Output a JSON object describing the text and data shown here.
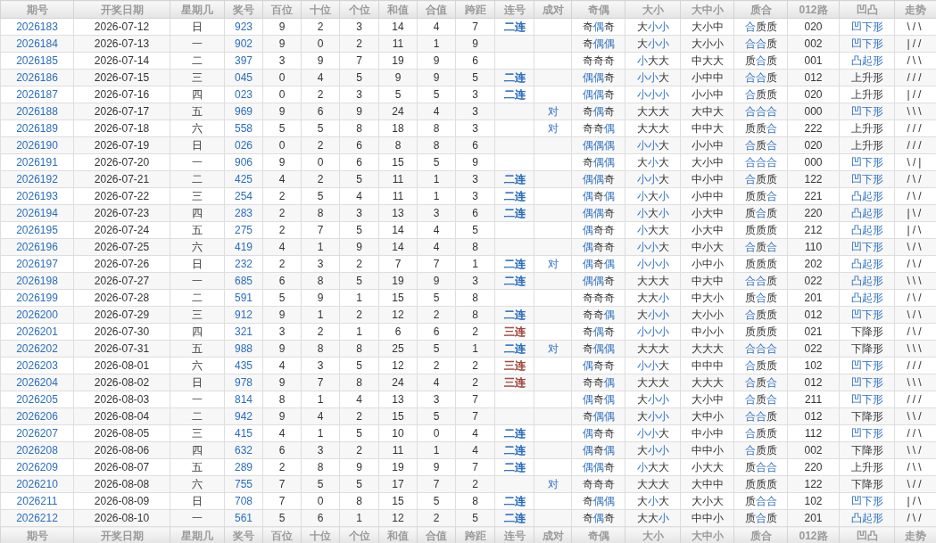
{
  "header": [
    "期号",
    "开奖日期",
    "星期几",
    "奖号",
    "百位",
    "十位",
    "个位",
    "和值",
    "合值",
    "跨距",
    "连号",
    "成对",
    "奇偶",
    "大小",
    "大中小",
    "质合",
    "012路",
    "凹凸",
    "走势"
  ],
  "rows": [
    {
      "issue": "2026183",
      "date": "2026-07-12",
      "weekday": "日",
      "number": "923",
      "hundreds": "9",
      "tens": "2",
      "units": "3",
      "sum": "14",
      "sum_tail": "4",
      "span": "7",
      "consecutive": {
        "text": "二连",
        "color": "#2a6ebf"
      },
      "odd_even": [
        {
          "ch": "奇",
          "hl": false
        },
        {
          "ch": "偶",
          "hl": true
        },
        {
          "ch": "奇",
          "hl": false
        }
      ],
      "big_small": [
        {
          "ch": "大",
          "hl": false
        },
        {
          "ch": "小",
          "hl": true
        },
        {
          "ch": "小",
          "hl": true
        }
      ],
      "big_mid_small": "大小中",
      "prime_composite": [
        {
          "ch": "合",
          "hl": true
        },
        {
          "ch": "质",
          "hl": false
        },
        {
          "ch": "质",
          "hl": false
        }
      ],
      "route_012": "020",
      "shape": {
        "text": "凹下形",
        "highlight": true
      },
      "trend": "\\/\\"
    },
    {
      "issue": "2026184",
      "date": "2026-07-13",
      "weekday": "一",
      "number": "902",
      "hundreds": "9",
      "tens": "0",
      "units": "2",
      "sum": "11",
      "sum_tail": "1",
      "span": "9",
      "odd_even": [
        {
          "ch": "奇",
          "hl": false
        },
        {
          "ch": "偶",
          "hl": true
        },
        {
          "ch": "偶",
          "hl": true
        }
      ],
      "big_small": [
        {
          "ch": "大",
          "hl": false
        },
        {
          "ch": "小",
          "hl": true
        },
        {
          "ch": "小",
          "hl": true
        }
      ],
      "big_mid_small": "大小小",
      "prime_composite": [
        {
          "ch": "合",
          "hl": true
        },
        {
          "ch": "合",
          "hl": true
        },
        {
          "ch": "质",
          "hl": false
        }
      ],
      "route_012": "002",
      "shape": {
        "text": "凹下形",
        "highlight": true
      },
      "trend": "|//"
    },
    {
      "issue": "2026185",
      "date": "2026-07-14",
      "weekday": "二",
      "number": "397",
      "hundreds": "3",
      "tens": "9",
      "units": "7",
      "sum": "19",
      "sum_tail": "9",
      "span": "6",
      "odd_even": [
        {
          "ch": "奇",
          "hl": false
        },
        {
          "ch": "奇",
          "hl": false
        },
        {
          "ch": "奇",
          "hl": false
        }
      ],
      "big_small": [
        {
          "ch": "小",
          "hl": true
        },
        {
          "ch": "大",
          "hl": false
        },
        {
          "ch": "大",
          "hl": false
        }
      ],
      "big_mid_small": "中大大",
      "prime_composite": [
        {
          "ch": "质",
          "hl": false
        },
        {
          "ch": "合",
          "hl": true
        },
        {
          "ch": "质",
          "hl": false
        }
      ],
      "route_012": "001",
      "shape": {
        "text": "凸起形",
        "highlight": true
      },
      "trend": "/\\\\"
    },
    {
      "issue": "2026186",
      "date": "2026-07-15",
      "weekday": "三",
      "number": "045",
      "hundreds": "0",
      "tens": "4",
      "units": "5",
      "sum": "9",
      "sum_tail": "9",
      "span": "5",
      "consecutive": {
        "text": "二连",
        "color": "#2a6ebf"
      },
      "odd_even": [
        {
          "ch": "偶",
          "hl": true
        },
        {
          "ch": "偶",
          "hl": true
        },
        {
          "ch": "奇",
          "hl": false
        }
      ],
      "big_small": [
        {
          "ch": "小",
          "hl": true
        },
        {
          "ch": "小",
          "hl": true
        },
        {
          "ch": "大",
          "hl": false
        }
      ],
      "big_mid_small": "小中中",
      "prime_composite": [
        {
          "ch": "合",
          "hl": true
        },
        {
          "ch": "合",
          "hl": true
        },
        {
          "ch": "质",
          "hl": false
        }
      ],
      "route_012": "012",
      "shape": {
        "text": "上升形",
        "highlight": false
      },
      "trend": "///"
    },
    {
      "issue": "2026187",
      "date": "2026-07-16",
      "weekday": "四",
      "number": "023",
      "hundreds": "0",
      "tens": "2",
      "units": "3",
      "sum": "5",
      "sum_tail": "5",
      "span": "3",
      "consecutive": {
        "text": "二连",
        "color": "#2a6ebf"
      },
      "odd_even": [
        {
          "ch": "偶",
          "hl": true
        },
        {
          "ch": "偶",
          "hl": true
        },
        {
          "ch": "奇",
          "hl": false
        }
      ],
      "big_small": [
        {
          "ch": "小",
          "hl": true
        },
        {
          "ch": "小",
          "hl": true
        },
        {
          "ch": "小",
          "hl": true
        }
      ],
      "big_mid_small": "小小中",
      "prime_composite": [
        {
          "ch": "合",
          "hl": true
        },
        {
          "ch": "质",
          "hl": false
        },
        {
          "ch": "质",
          "hl": false
        }
      ],
      "route_012": "020",
      "shape": {
        "text": "上升形",
        "highlight": false
      },
      "trend": "|//"
    },
    {
      "issue": "2026188",
      "date": "2026-07-17",
      "weekday": "五",
      "number": "969",
      "hundreds": "9",
      "tens": "6",
      "units": "9",
      "sum": "24",
      "sum_tail": "4",
      "span": "3",
      "pair": "对",
      "odd_even": [
        {
          "ch": "奇",
          "hl": false
        },
        {
          "ch": "偶",
          "hl": true
        },
        {
          "ch": "奇",
          "hl": false
        }
      ],
      "big_small": [
        {
          "ch": "大",
          "hl": false
        },
        {
          "ch": "大",
          "hl": false
        },
        {
          "ch": "大",
          "hl": false
        }
      ],
      "big_mid_small": "大中大",
      "prime_composite": [
        {
          "ch": "合",
          "hl": true
        },
        {
          "ch": "合",
          "hl": true
        },
        {
          "ch": "合",
          "hl": true
        }
      ],
      "route_012": "000",
      "shape": {
        "text": "凹下形",
        "highlight": true
      },
      "trend": "\\\\\\"
    },
    {
      "issue": "2026189",
      "date": "2026-07-18",
      "weekday": "六",
      "number": "558",
      "hundreds": "5",
      "tens": "5",
      "units": "8",
      "sum": "18",
      "sum_tail": "8",
      "span": "3",
      "pair": "对",
      "odd_even": [
        {
          "ch": "奇",
          "hl": false
        },
        {
          "ch": "奇",
          "hl": false
        },
        {
          "ch": "偶",
          "hl": true
        }
      ],
      "big_small": [
        {
          "ch": "大",
          "hl": false
        },
        {
          "ch": "大",
          "hl": false
        },
        {
          "ch": "大",
          "hl": false
        }
      ],
      "big_mid_small": "中中大",
      "prime_composite": [
        {
          "ch": "质",
          "hl": false
        },
        {
          "ch": "质",
          "hl": false
        },
        {
          "ch": "合",
          "hl": true
        }
      ],
      "route_012": "222",
      "shape": {
        "text": "上升形",
        "highlight": false
      },
      "trend": "///"
    },
    {
      "issue": "2026190",
      "date": "2026-07-19",
      "weekday": "日",
      "number": "026",
      "hundreds": "0",
      "tens": "2",
      "units": "6",
      "sum": "8",
      "sum_tail": "8",
      "span": "6",
      "odd_even": [
        {
          "ch": "偶",
          "hl": true
        },
        {
          "ch": "偶",
          "hl": true
        },
        {
          "ch": "偶",
          "hl": true
        }
      ],
      "big_small": [
        {
          "ch": "小",
          "hl": true
        },
        {
          "ch": "小",
          "hl": true
        },
        {
          "ch": "大",
          "hl": false
        }
      ],
      "big_mid_small": "小小中",
      "prime_composite": [
        {
          "ch": "合",
          "hl": true
        },
        {
          "ch": "质",
          "hl": false
        },
        {
          "ch": "合",
          "hl": true
        }
      ],
      "route_012": "020",
      "shape": {
        "text": "上升形",
        "highlight": false
      },
      "trend": "///"
    },
    {
      "issue": "2026191",
      "date": "2026-07-20",
      "weekday": "一",
      "number": "906",
      "hundreds": "9",
      "tens": "0",
      "units": "6",
      "sum": "15",
      "sum_tail": "5",
      "span": "9",
      "odd_even": [
        {
          "ch": "奇",
          "hl": false
        },
        {
          "ch": "偶",
          "hl": true
        },
        {
          "ch": "偶",
          "hl": true
        }
      ],
      "big_small": [
        {
          "ch": "大",
          "hl": false
        },
        {
          "ch": "小",
          "hl": true
        },
        {
          "ch": "大",
          "hl": false
        }
      ],
      "big_mid_small": "大小中",
      "prime_composite": [
        {
          "ch": "合",
          "hl": true
        },
        {
          "ch": "合",
          "hl": true
        },
        {
          "ch": "合",
          "hl": true
        }
      ],
      "route_012": "000",
      "shape": {
        "text": "凹下形",
        "highlight": true
      },
      "trend": "\\/|"
    },
    {
      "issue": "2026192",
      "date": "2026-07-21",
      "weekday": "二",
      "number": "425",
      "hundreds": "4",
      "tens": "2",
      "units": "5",
      "sum": "11",
      "sum_tail": "1",
      "span": "3",
      "consecutive": {
        "text": "二连",
        "color": "#2a6ebf"
      },
      "odd_even": [
        {
          "ch": "偶",
          "hl": true
        },
        {
          "ch": "偶",
          "hl": true
        },
        {
          "ch": "奇",
          "hl": false
        }
      ],
      "big_small": [
        {
          "ch": "小",
          "hl": true
        },
        {
          "ch": "小",
          "hl": true
        },
        {
          "ch": "大",
          "hl": false
        }
      ],
      "big_mid_small": "中小中",
      "prime_composite": [
        {
          "ch": "合",
          "hl": true
        },
        {
          "ch": "质",
          "hl": false
        },
        {
          "ch": "质",
          "hl": false
        }
      ],
      "route_012": "122",
      "shape": {
        "text": "凹下形",
        "highlight": true
      },
      "trend": "/\\/"
    },
    {
      "issue": "2026193",
      "date": "2026-07-22",
      "weekday": "三",
      "number": "254",
      "hundreds": "2",
      "tens": "5",
      "units": "4",
      "sum": "11",
      "sum_tail": "1",
      "span": "3",
      "consecutive": {
        "text": "二连",
        "color": "#2a6ebf"
      },
      "odd_even": [
        {
          "ch": "偶",
          "hl": true
        },
        {
          "ch": "奇",
          "hl": false
        },
        {
          "ch": "偶",
          "hl": true
        }
      ],
      "big_small": [
        {
          "ch": "小",
          "hl": true
        },
        {
          "ch": "大",
          "hl": false
        },
        {
          "ch": "小",
          "hl": true
        }
      ],
      "big_mid_small": "小中中",
      "prime_composite": [
        {
          "ch": "质",
          "hl": false
        },
        {
          "ch": "质",
          "hl": false
        },
        {
          "ch": "合",
          "hl": true
        }
      ],
      "route_012": "221",
      "shape": {
        "text": "凸起形",
        "highlight": true
      },
      "trend": "/\\/"
    },
    {
      "issue": "2026194",
      "date": "2026-07-23",
      "weekday": "四",
      "number": "283",
      "hundreds": "2",
      "tens": "8",
      "units": "3",
      "sum": "13",
      "sum_tail": "3",
      "span": "6",
      "consecutive": {
        "text": "二连",
        "color": "#2a6ebf"
      },
      "odd_even": [
        {
          "ch": "偶",
          "hl": true
        },
        {
          "ch": "偶",
          "hl": true
        },
        {
          "ch": "奇",
          "hl": false
        }
      ],
      "big_small": [
        {
          "ch": "小",
          "hl": true
        },
        {
          "ch": "大",
          "hl": false
        },
        {
          "ch": "小",
          "hl": true
        }
      ],
      "big_mid_small": "小大中",
      "prime_composite": [
        {
          "ch": "质",
          "hl": false
        },
        {
          "ch": "合",
          "hl": true
        },
        {
          "ch": "质",
          "hl": false
        }
      ],
      "route_012": "220",
      "shape": {
        "text": "凸起形",
        "highlight": true
      },
      "trend": "|\\/"
    },
    {
      "issue": "2026195",
      "date": "2026-07-24",
      "weekday": "五",
      "number": "275",
      "hundreds": "2",
      "tens": "7",
      "units": "5",
      "sum": "14",
      "sum_tail": "4",
      "span": "5",
      "odd_even": [
        {
          "ch": "偶",
          "hl": true
        },
        {
          "ch": "奇",
          "hl": false
        },
        {
          "ch": "奇",
          "hl": false
        }
      ],
      "big_small": [
        {
          "ch": "小",
          "hl": true
        },
        {
          "ch": "大",
          "hl": false
        },
        {
          "ch": "大",
          "hl": false
        }
      ],
      "big_mid_small": "小大中",
      "prime_composite": [
        {
          "ch": "质",
          "hl": false
        },
        {
          "ch": "质",
          "hl": false
        },
        {
          "ch": "质",
          "hl": false
        }
      ],
      "route_012": "212",
      "shape": {
        "text": "凸起形",
        "highlight": true
      },
      "trend": "|/\\"
    },
    {
      "issue": "2026196",
      "date": "2026-07-25",
      "weekday": "六",
      "number": "419",
      "hundreds": "4",
      "tens": "1",
      "units": "9",
      "sum": "14",
      "sum_tail": "4",
      "span": "8",
      "odd_even": [
        {
          "ch": "偶",
          "hl": true
        },
        {
          "ch": "奇",
          "hl": false
        },
        {
          "ch": "奇",
          "hl": false
        }
      ],
      "big_small": [
        {
          "ch": "小",
          "hl": true
        },
        {
          "ch": "小",
          "hl": true
        },
        {
          "ch": "大",
          "hl": false
        }
      ],
      "big_mid_small": "中小大",
      "prime_composite": [
        {
          "ch": "合",
          "hl": true
        },
        {
          "ch": "质",
          "hl": false
        },
        {
          "ch": "合",
          "hl": true
        }
      ],
      "route_012": "110",
      "shape": {
        "text": "凹下形",
        "highlight": true
      },
      "trend": "\\/\\"
    },
    {
      "issue": "2026197",
      "date": "2026-07-26",
      "weekday": "日",
      "number": "232",
      "hundreds": "2",
      "tens": "3",
      "units": "2",
      "sum": "7",
      "sum_tail": "7",
      "span": "1",
      "consecutive": {
        "text": "二连",
        "color": "#2a6ebf"
      },
      "pair": "对",
      "odd_even": [
        {
          "ch": "偶",
          "hl": true
        },
        {
          "ch": "奇",
          "hl": false
        },
        {
          "ch": "偶",
          "hl": true
        }
      ],
      "big_small": [
        {
          "ch": "小",
          "hl": true
        },
        {
          "ch": "小",
          "hl": true
        },
        {
          "ch": "小",
          "hl": true
        }
      ],
      "big_mid_small": "小中小",
      "prime_composite": [
        {
          "ch": "质",
          "hl": false
        },
        {
          "ch": "质",
          "hl": false
        },
        {
          "ch": "质",
          "hl": false
        }
      ],
      "route_012": "202",
      "shape": {
        "text": "凸起形",
        "highlight": true
      },
      "trend": "/\\/"
    },
    {
      "issue": "2026198",
      "date": "2026-07-27",
      "weekday": "一",
      "number": "685",
      "hundreds": "6",
      "tens": "8",
      "units": "5",
      "sum": "19",
      "sum_tail": "9",
      "span": "3",
      "consecutive": {
        "text": "二连",
        "color": "#2a6ebf"
      },
      "odd_even": [
        {
          "ch": "偶",
          "hl": true
        },
        {
          "ch": "偶",
          "hl": true
        },
        {
          "ch": "奇",
          "hl": false
        }
      ],
      "big_small": [
        {
          "ch": "大",
          "hl": false
        },
        {
          "ch": "大",
          "hl": false
        },
        {
          "ch": "大",
          "hl": false
        }
      ],
      "big_mid_small": "中大中",
      "prime_composite": [
        {
          "ch": "合",
          "hl": true
        },
        {
          "ch": "合",
          "hl": true
        },
        {
          "ch": "质",
          "hl": false
        }
      ],
      "route_012": "022",
      "shape": {
        "text": "凸起形",
        "highlight": true
      },
      "trend": "\\\\\\"
    },
    {
      "issue": "2026199",
      "date": "2026-07-28",
      "weekday": "二",
      "number": "591",
      "hundreds": "5",
      "tens": "9",
      "units": "1",
      "sum": "15",
      "sum_tail": "5",
      "span": "8",
      "odd_even": [
        {
          "ch": "奇",
          "hl": false
        },
        {
          "ch": "奇",
          "hl": false
        },
        {
          "ch": "奇",
          "hl": false
        }
      ],
      "big_small": [
        {
          "ch": "大",
          "hl": false
        },
        {
          "ch": "大",
          "hl": false
        },
        {
          "ch": "小",
          "hl": true
        }
      ],
      "big_mid_small": "中大小",
      "prime_composite": [
        {
          "ch": "质",
          "hl": false
        },
        {
          "ch": "合",
          "hl": true
        },
        {
          "ch": "质",
          "hl": false
        }
      ],
      "route_012": "201",
      "shape": {
        "text": "凸起形",
        "highlight": true
      },
      "trend": "/\\/"
    },
    {
      "issue": "2026200",
      "date": "2026-07-29",
      "weekday": "三",
      "number": "912",
      "hundreds": "9",
      "tens": "1",
      "units": "2",
      "sum": "12",
      "sum_tail": "2",
      "span": "8",
      "consecutive": {
        "text": "二连",
        "color": "#2a6ebf"
      },
      "odd_even": [
        {
          "ch": "奇",
          "hl": false
        },
        {
          "ch": "奇",
          "hl": false
        },
        {
          "ch": "偶",
          "hl": true
        }
      ],
      "big_small": [
        {
          "ch": "大",
          "hl": false
        },
        {
          "ch": "小",
          "hl": true
        },
        {
          "ch": "小",
          "hl": true
        }
      ],
      "big_mid_small": "大小小",
      "prime_composite": [
        {
          "ch": "合",
          "hl": true
        },
        {
          "ch": "质",
          "hl": false
        },
        {
          "ch": "质",
          "hl": false
        }
      ],
      "route_012": "012",
      "shape": {
        "text": "凹下形",
        "highlight": true
      },
      "trend": "\\/\\"
    },
    {
      "issue": "2026201",
      "date": "2026-07-30",
      "weekday": "四",
      "number": "321",
      "hundreds": "3",
      "tens": "2",
      "units": "1",
      "sum": "6",
      "sum_tail": "6",
      "span": "2",
      "consecutive": {
        "text": "三连",
        "color": "#a0473d"
      },
      "odd_even": [
        {
          "ch": "奇",
          "hl": false
        },
        {
          "ch": "偶",
          "hl": true
        },
        {
          "ch": "奇",
          "hl": false
        }
      ],
      "big_small": [
        {
          "ch": "小",
          "hl": true
        },
        {
          "ch": "小",
          "hl": true
        },
        {
          "ch": "小",
          "hl": true
        }
      ],
      "big_mid_small": "中小小",
      "prime_composite": [
        {
          "ch": "质",
          "hl": false
        },
        {
          "ch": "质",
          "hl": false
        },
        {
          "ch": "质",
          "hl": false
        }
      ],
      "route_012": "021",
      "shape": {
        "text": "下降形",
        "highlight": false
      },
      "trend": "/\\/"
    },
    {
      "issue": "2026202",
      "date": "2026-07-31",
      "weekday": "五",
      "number": "988",
      "hundreds": "9",
      "tens": "8",
      "units": "8",
      "sum": "25",
      "sum_tail": "5",
      "span": "1",
      "consecutive": {
        "text": "二连",
        "color": "#2a6ebf"
      },
      "pair": "对",
      "odd_even": [
        {
          "ch": "奇",
          "hl": false
        },
        {
          "ch": "偶",
          "hl": true
        },
        {
          "ch": "偶",
          "hl": true
        }
      ],
      "big_small": [
        {
          "ch": "大",
          "hl": false
        },
        {
          "ch": "大",
          "hl": false
        },
        {
          "ch": "大",
          "hl": false
        }
      ],
      "big_mid_small": "大大大",
      "prime_composite": [
        {
          "ch": "合",
          "hl": true
        },
        {
          "ch": "合",
          "hl": true
        },
        {
          "ch": "合",
          "hl": true
        }
      ],
      "route_012": "022",
      "shape": {
        "text": "下降形",
        "highlight": false
      },
      "trend": "\\\\\\"
    },
    {
      "issue": "2026203",
      "date": "2026-08-01",
      "weekday": "六",
      "number": "435",
      "hundreds": "4",
      "tens": "3",
      "units": "5",
      "sum": "12",
      "sum_tail": "2",
      "span": "2",
      "consecutive": {
        "text": "三连",
        "color": "#a0473d"
      },
      "odd_even": [
        {
          "ch": "偶",
          "hl": true
        },
        {
          "ch": "奇",
          "hl": false
        },
        {
          "ch": "奇",
          "hl": false
        }
      ],
      "big_small": [
        {
          "ch": "小",
          "hl": true
        },
        {
          "ch": "小",
          "hl": true
        },
        {
          "ch": "大",
          "hl": false
        }
      ],
      "big_mid_small": "中中中",
      "prime_composite": [
        {
          "ch": "合",
          "hl": true
        },
        {
          "ch": "质",
          "hl": false
        },
        {
          "ch": "质",
          "hl": false
        }
      ],
      "route_012": "102",
      "shape": {
        "text": "凹下形",
        "highlight": true
      },
      "trend": "///"
    },
    {
      "issue": "2026204",
      "date": "2026-08-02",
      "weekday": "日",
      "number": "978",
      "hundreds": "9",
      "tens": "7",
      "units": "8",
      "sum": "24",
      "sum_tail": "4",
      "span": "2",
      "consecutive": {
        "text": "三连",
        "color": "#a0473d"
      },
      "odd_even": [
        {
          "ch": "奇",
          "hl": false
        },
        {
          "ch": "奇",
          "hl": false
        },
        {
          "ch": "偶",
          "hl": true
        }
      ],
      "big_small": [
        {
          "ch": "大",
          "hl": false
        },
        {
          "ch": "大",
          "hl": false
        },
        {
          "ch": "大",
          "hl": false
        }
      ],
      "big_mid_small": "大大大",
      "prime_composite": [
        {
          "ch": "合",
          "hl": true
        },
        {
          "ch": "质",
          "hl": false
        },
        {
          "ch": "合",
          "hl": true
        }
      ],
      "route_012": "012",
      "shape": {
        "text": "凹下形",
        "highlight": true
      },
      "trend": "\\\\\\"
    },
    {
      "issue": "2026205",
      "date": "2026-08-03",
      "weekday": "一",
      "number": "814",
      "hundreds": "8",
      "tens": "1",
      "units": "4",
      "sum": "13",
      "sum_tail": "3",
      "span": "7",
      "odd_even": [
        {
          "ch": "偶",
          "hl": true
        },
        {
          "ch": "奇",
          "hl": false
        },
        {
          "ch": "偶",
          "hl": true
        }
      ],
      "big_small": [
        {
          "ch": "大",
          "hl": false
        },
        {
          "ch": "小",
          "hl": true
        },
        {
          "ch": "小",
          "hl": true
        }
      ],
      "big_mid_small": "大小中",
      "prime_composite": [
        {
          "ch": "合",
          "hl": true
        },
        {
          "ch": "质",
          "hl": false
        },
        {
          "ch": "合",
          "hl": true
        }
      ],
      "route_012": "211",
      "shape": {
        "text": "凹下形",
        "highlight": true
      },
      "trend": "///"
    },
    {
      "issue": "2026206",
      "date": "2026-08-04",
      "weekday": "二",
      "number": "942",
      "hundreds": "9",
      "tens": "4",
      "units": "2",
      "sum": "15",
      "sum_tail": "5",
      "span": "7",
      "odd_even": [
        {
          "ch": "奇",
          "hl": false
        },
        {
          "ch": "偶",
          "hl": true
        },
        {
          "ch": "偶",
          "hl": true
        }
      ],
      "big_small": [
        {
          "ch": "大",
          "hl": false
        },
        {
          "ch": "小",
          "hl": true
        },
        {
          "ch": "小",
          "hl": true
        }
      ],
      "big_mid_small": "大中小",
      "prime_composite": [
        {
          "ch": "合",
          "hl": true
        },
        {
          "ch": "合",
          "hl": true
        },
        {
          "ch": "质",
          "hl": false
        }
      ],
      "route_012": "012",
      "shape": {
        "text": "下降形",
        "highlight": false
      },
      "trend": "\\\\/"
    },
    {
      "issue": "2026207",
      "date": "2026-08-05",
      "weekday": "三",
      "number": "415",
      "hundreds": "4",
      "tens": "1",
      "units": "5",
      "sum": "10",
      "sum_tail": "0",
      "span": "4",
      "consecutive": {
        "text": "二连",
        "color": "#2a6ebf"
      },
      "odd_even": [
        {
          "ch": "偶",
          "hl": true
        },
        {
          "ch": "奇",
          "hl": false
        },
        {
          "ch": "奇",
          "hl": false
        }
      ],
      "big_small": [
        {
          "ch": "小",
          "hl": true
        },
        {
          "ch": "小",
          "hl": true
        },
        {
          "ch": "大",
          "hl": false
        }
      ],
      "big_mid_small": "中小中",
      "prime_composite": [
        {
          "ch": "合",
          "hl": true
        },
        {
          "ch": "质",
          "hl": false
        },
        {
          "ch": "质",
          "hl": false
        }
      ],
      "route_012": "112",
      "shape": {
        "text": "凹下形",
        "highlight": true
      },
      "trend": "//\\"
    },
    {
      "issue": "2026208",
      "date": "2026-08-06",
      "weekday": "四",
      "number": "632",
      "hundreds": "6",
      "tens": "3",
      "units": "2",
      "sum": "11",
      "sum_tail": "1",
      "span": "4",
      "consecutive": {
        "text": "二连",
        "color": "#2a6ebf"
      },
      "odd_even": [
        {
          "ch": "偶",
          "hl": true
        },
        {
          "ch": "奇",
          "hl": false
        },
        {
          "ch": "偶",
          "hl": true
        }
      ],
      "big_small": [
        {
          "ch": "大",
          "hl": false
        },
        {
          "ch": "小",
          "hl": true
        },
        {
          "ch": "小",
          "hl": true
        }
      ],
      "big_mid_small": "中中小",
      "prime_composite": [
        {
          "ch": "合",
          "hl": true
        },
        {
          "ch": "质",
          "hl": false
        },
        {
          "ch": "质",
          "hl": false
        }
      ],
      "route_012": "002",
      "shape": {
        "text": "下降形",
        "highlight": false
      },
      "trend": "\\\\/"
    },
    {
      "issue": "2026209",
      "date": "2026-08-07",
      "weekday": "五",
      "number": "289",
      "hundreds": "2",
      "tens": "8",
      "units": "9",
      "sum": "19",
      "sum_tail": "9",
      "span": "7",
      "consecutive": {
        "text": "二连",
        "color": "#2a6ebf"
      },
      "odd_even": [
        {
          "ch": "偶",
          "hl": true
        },
        {
          "ch": "偶",
          "hl": true
        },
        {
          "ch": "奇",
          "hl": false
        }
      ],
      "big_small": [
        {
          "ch": "小",
          "hl": true
        },
        {
          "ch": "大",
          "hl": false
        },
        {
          "ch": "大",
          "hl": false
        }
      ],
      "big_mid_small": "小大大",
      "prime_composite": [
        {
          "ch": "质",
          "hl": false
        },
        {
          "ch": "合",
          "hl": true
        },
        {
          "ch": "合",
          "hl": true
        }
      ],
      "route_012": "220",
      "shape": {
        "text": "上升形",
        "highlight": false
      },
      "trend": "/\\\\"
    },
    {
      "issue": "2026210",
      "date": "2026-08-08",
      "weekday": "六",
      "number": "755",
      "hundreds": "7",
      "tens": "5",
      "units": "5",
      "sum": "17",
      "sum_tail": "7",
      "span": "2",
      "pair": "对",
      "odd_even": [
        {
          "ch": "奇",
          "hl": false
        },
        {
          "ch": "奇",
          "hl": false
        },
        {
          "ch": "奇",
          "hl": false
        }
      ],
      "big_small": [
        {
          "ch": "大",
          "hl": false
        },
        {
          "ch": "大",
          "hl": false
        },
        {
          "ch": "大",
          "hl": false
        }
      ],
      "big_mid_small": "大中中",
      "prime_composite": [
        {
          "ch": "质",
          "hl": false
        },
        {
          "ch": "质",
          "hl": false
        },
        {
          "ch": "质",
          "hl": false
        }
      ],
      "route_012": "122",
      "shape": {
        "text": "下降形",
        "highlight": false
      },
      "trend": "\\//"
    },
    {
      "issue": "2026211",
      "date": "2026-08-09",
      "weekday": "日",
      "number": "708",
      "hundreds": "7",
      "tens": "0",
      "units": "8",
      "sum": "15",
      "sum_tail": "5",
      "span": "8",
      "consecutive": {
        "text": "二连",
        "color": "#2a6ebf"
      },
      "odd_even": [
        {
          "ch": "奇",
          "hl": false
        },
        {
          "ch": "偶",
          "hl": true
        },
        {
          "ch": "偶",
          "hl": true
        }
      ],
      "big_small": [
        {
          "ch": "大",
          "hl": false
        },
        {
          "ch": "小",
          "hl": true
        },
        {
          "ch": "大",
          "hl": false
        }
      ],
      "big_mid_small": "大小大",
      "prime_composite": [
        {
          "ch": "质",
          "hl": false
        },
        {
          "ch": "合",
          "hl": true
        },
        {
          "ch": "合",
          "hl": true
        }
      ],
      "route_012": "102",
      "shape": {
        "text": "凹下形",
        "highlight": true
      },
      "trend": "|/\\"
    },
    {
      "issue": "2026212",
      "date": "2026-08-10",
      "weekday": "一",
      "number": "561",
      "hundreds": "5",
      "tens": "6",
      "units": "1",
      "sum": "12",
      "sum_tail": "2",
      "span": "5",
      "consecutive": {
        "text": "二连",
        "color": "#2a6ebf"
      },
      "odd_even": [
        {
          "ch": "奇",
          "hl": false
        },
        {
          "ch": "偶",
          "hl": true
        },
        {
          "ch": "奇",
          "hl": false
        }
      ],
      "big_small": [
        {
          "ch": "大",
          "hl": false
        },
        {
          "ch": "大",
          "hl": false
        },
        {
          "ch": "小",
          "hl": true
        }
      ],
      "big_mid_small": "中中小",
      "prime_composite": [
        {
          "ch": "质",
          "hl": false
        },
        {
          "ch": "合",
          "hl": true
        },
        {
          "ch": "质",
          "hl": false
        }
      ],
      "route_012": "201",
      "shape": {
        "text": "凸起形",
        "highlight": true
      },
      "trend": "/\\/"
    }
  ],
  "footer": [
    "期号",
    "开奖日期",
    "星期几",
    "奖号",
    "百位",
    "十位",
    "个位",
    "和值",
    "合值",
    "跨距",
    "连号",
    "成对",
    "奇偶",
    "大小",
    "大中小",
    "质合",
    "012路",
    "凹凸",
    "走势"
  ]
}
